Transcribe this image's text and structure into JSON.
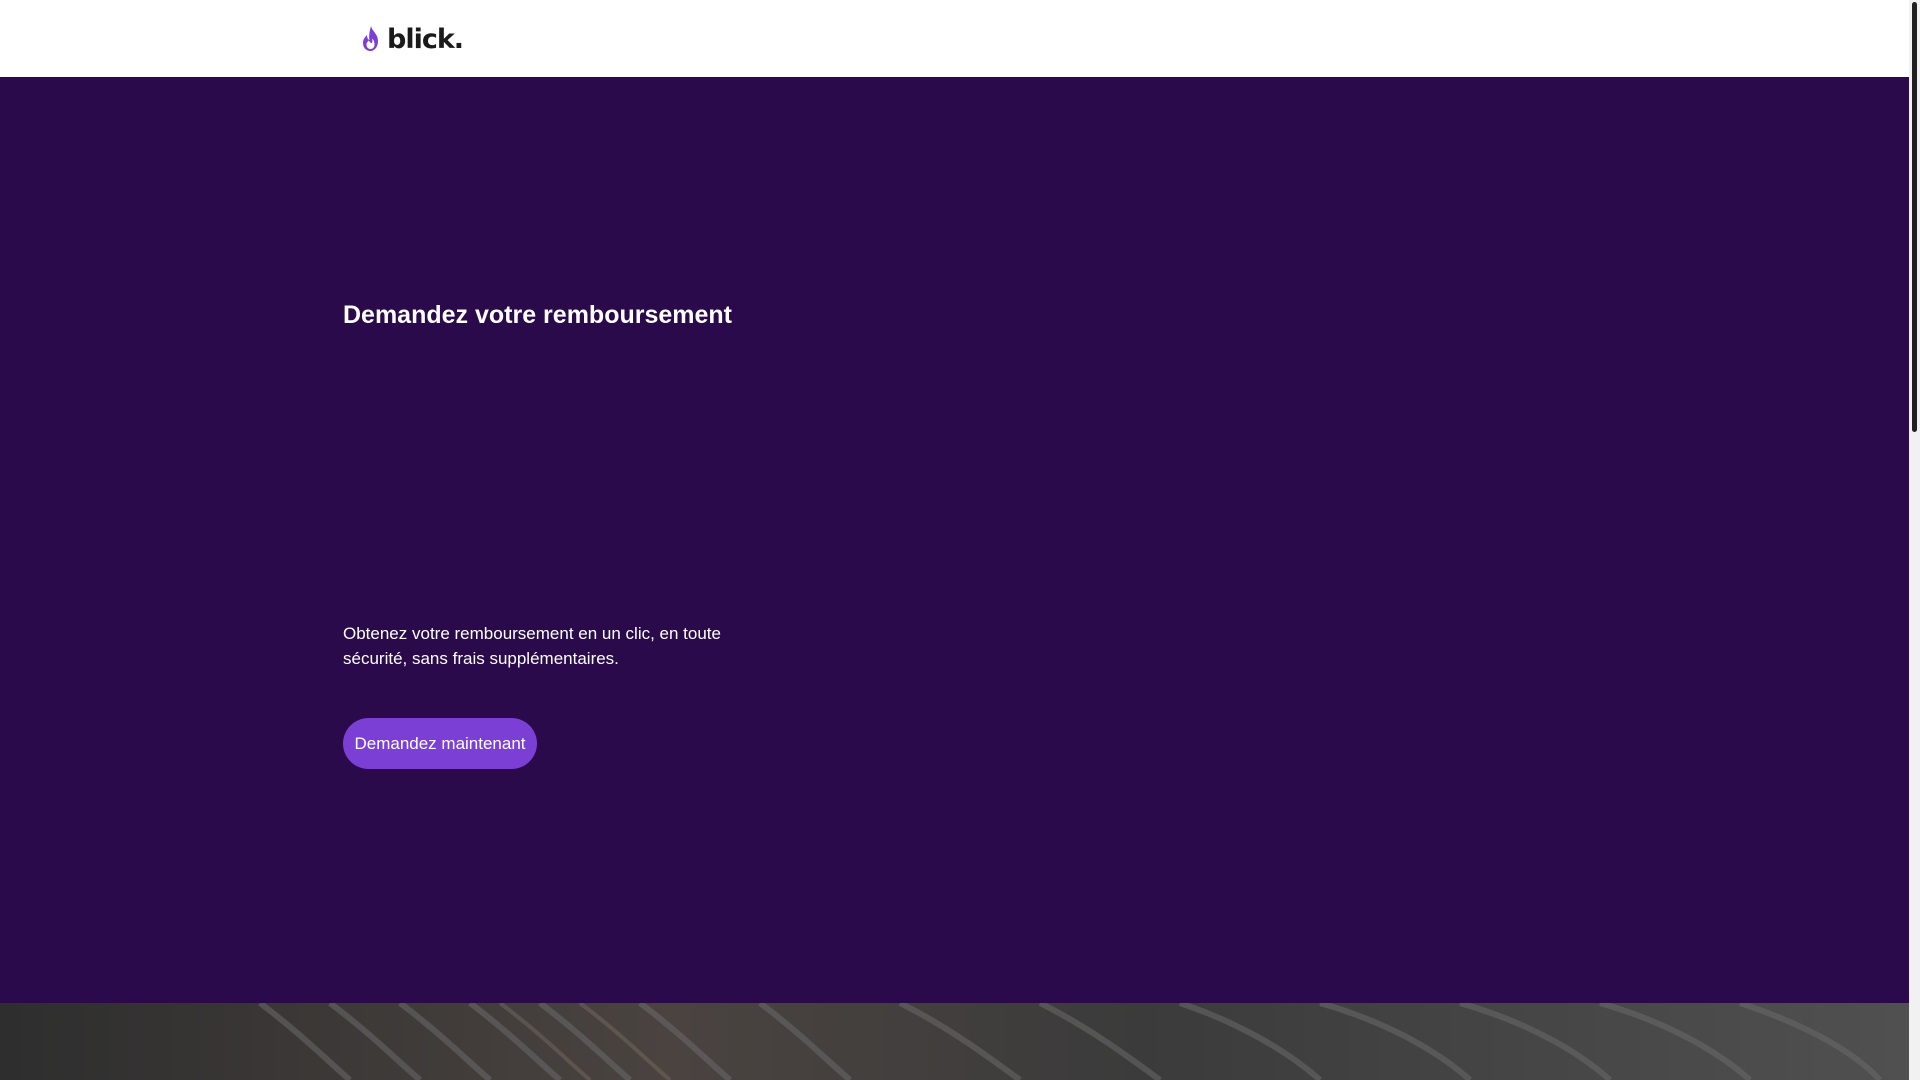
{
  "header": {
    "logo_text": "blick.",
    "logo_color": "#7b3fd6"
  },
  "hero": {
    "background": "#2a0a4a",
    "title": "Demandez votre remboursement",
    "description": "Obtenez votre remboursement en un clic, en toute sécurité, sans frais supplémentaires.",
    "cta_label": "Demandez maintenant",
    "cta_color": "#7b3fd6"
  },
  "icons": {
    "logo": "flame-icon"
  }
}
